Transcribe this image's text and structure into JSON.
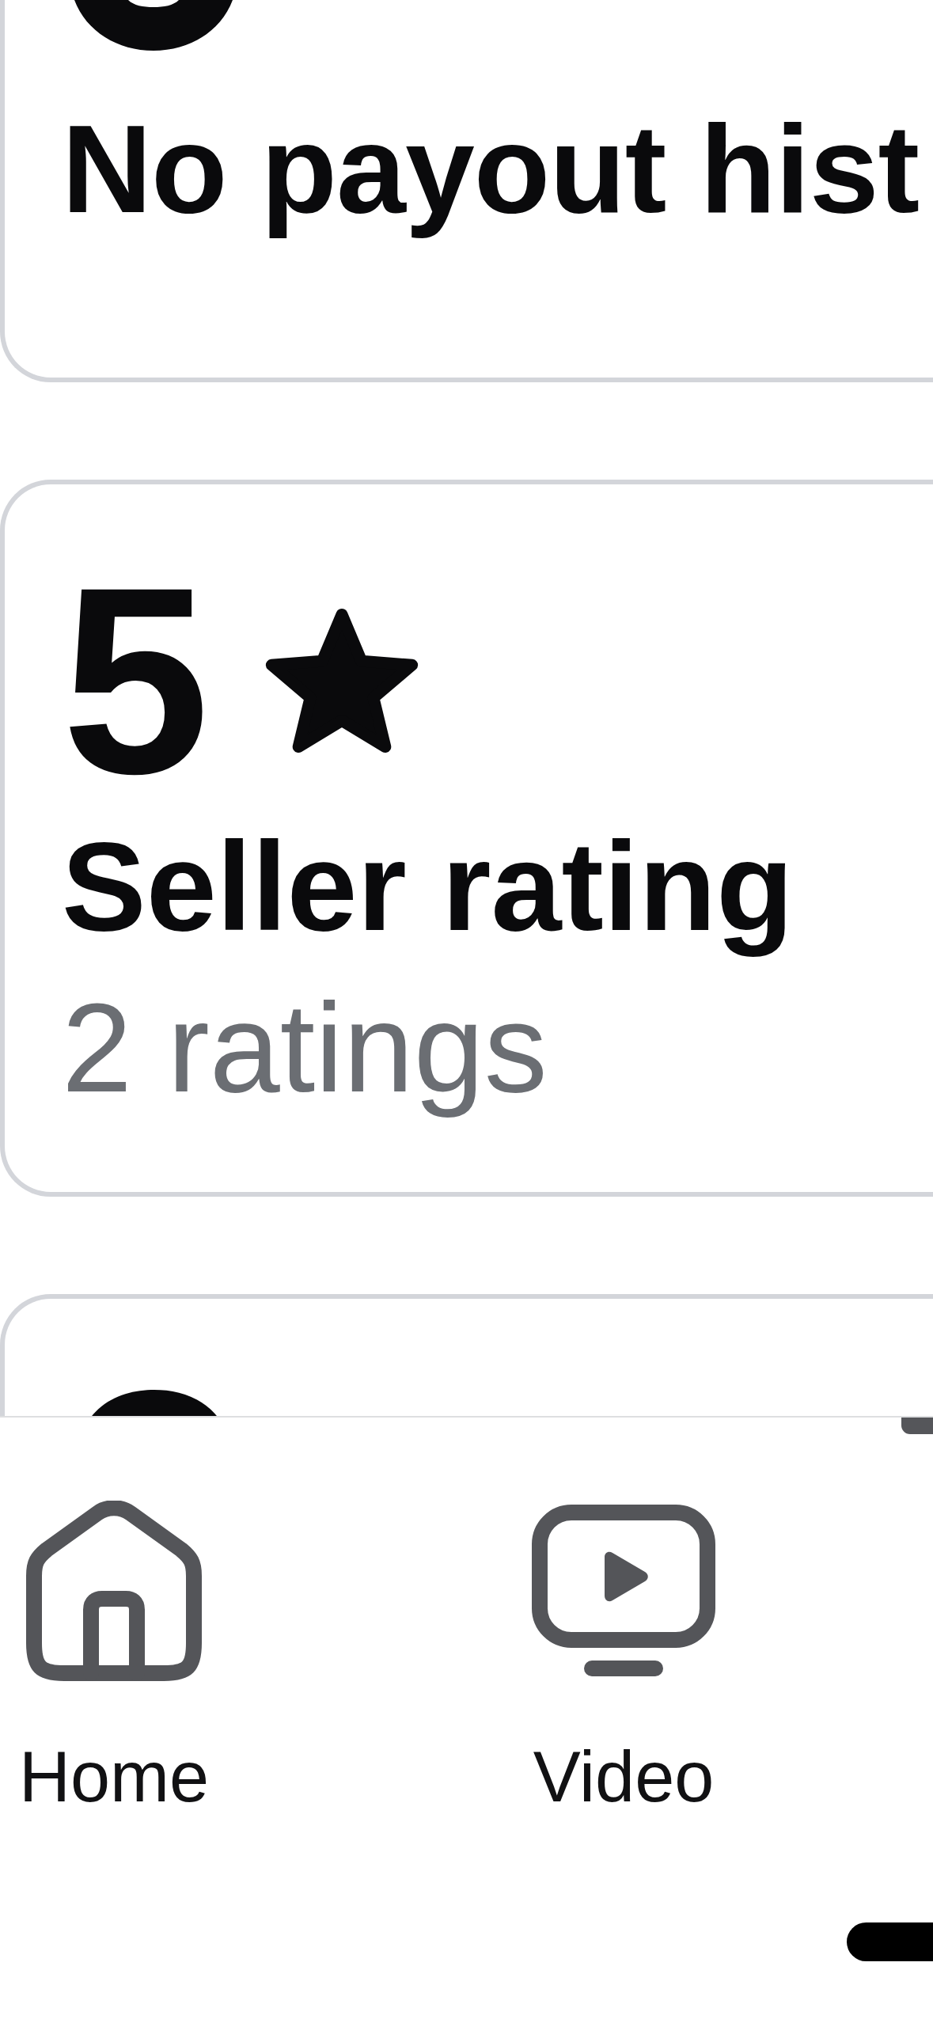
{
  "cards": [
    {
      "kind": "top_cut",
      "title": "No payout hist"
    },
    {
      "kind": "full",
      "value": "5",
      "title": "Seller rating",
      "subtitle": "2 ratings"
    },
    {
      "kind": "bottom_cut"
    }
  ],
  "bottom_nav": [
    {
      "label": "Home"
    },
    {
      "label": "Video"
    }
  ]
}
